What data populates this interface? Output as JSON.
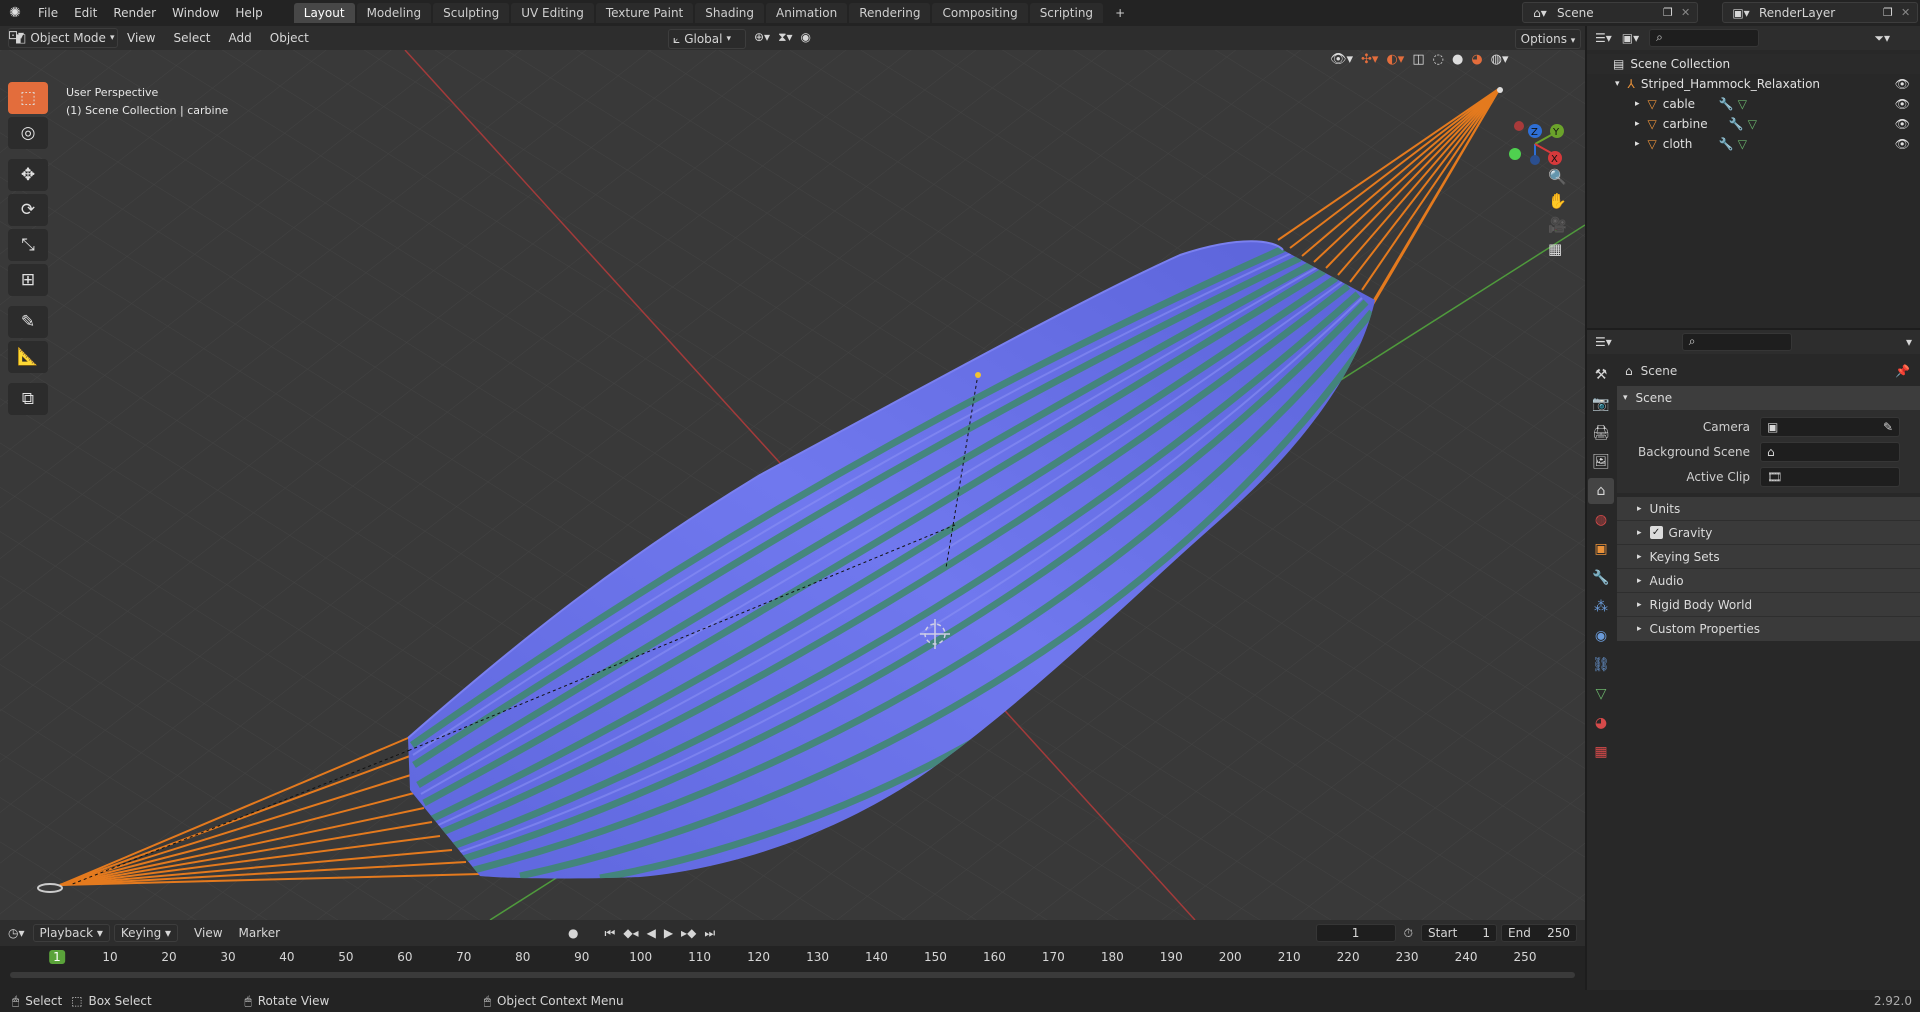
{
  "menubar": {
    "items": [
      "File",
      "Edit",
      "Render",
      "Window",
      "Help"
    ],
    "workspaces": [
      "Layout",
      "Modeling",
      "Sculpting",
      "UV Editing",
      "Texture Paint",
      "Shading",
      "Animation",
      "Rendering",
      "Compositing",
      "Scripting"
    ],
    "active_workspace": "Layout",
    "add_tab": "+",
    "scene_name": "Scene",
    "render_layer": "RenderLayer"
  },
  "viewport_header": {
    "mode": "Object Mode",
    "menus": [
      "View",
      "Select",
      "Add",
      "Object"
    ],
    "transform_orientation": "Global",
    "options_label": "Options"
  },
  "viewport": {
    "perspective_label": "User Perspective",
    "collection_label": "(1) Scene Collection | carbine",
    "gizmo": {
      "x": "X",
      "y": "Y",
      "z": "Z"
    },
    "colors": {
      "cloth_base": "#6d73e6",
      "stripe_green": "#3f8a6a",
      "ropes": "#e47a1e",
      "grid_red": "#b23b3b",
      "grid_green": "#4f9a3c",
      "background": "#3a3a3a"
    }
  },
  "outliner": {
    "root": "Scene Collection",
    "collection": "Striped_Hammock_Relaxation",
    "objects": [
      "cable",
      "carbine",
      "cloth"
    ]
  },
  "properties": {
    "breadcrumb": "Scene",
    "panel_title": "Scene",
    "fields": [
      {
        "label": "Camera",
        "value": ""
      },
      {
        "label": "Background Scene",
        "value": ""
      },
      {
        "label": "Active Clip",
        "value": ""
      }
    ],
    "sections": [
      "Units",
      "Gravity",
      "Keying Sets",
      "Audio",
      "Rigid Body World",
      "Custom Properties"
    ],
    "gravity_checked": true
  },
  "timeline": {
    "menus": [
      "Playback",
      "Keying",
      "View",
      "Marker"
    ],
    "current_frame": "1",
    "start_label": "Start",
    "start_value": "1",
    "end_label": "End",
    "end_value": "250",
    "ticks": [
      "1",
      "10",
      "20",
      "30",
      "40",
      "50",
      "60",
      "70",
      "80",
      "90",
      "100",
      "110",
      "120",
      "130",
      "140",
      "150",
      "160",
      "170",
      "180",
      "190",
      "200",
      "210",
      "220",
      "230",
      "240",
      "250"
    ]
  },
  "statusbar": {
    "select": "Select",
    "box_select": "Box Select",
    "rotate_view": "Rotate View",
    "context_menu": "Object Context Menu",
    "version": "2.92.0"
  }
}
